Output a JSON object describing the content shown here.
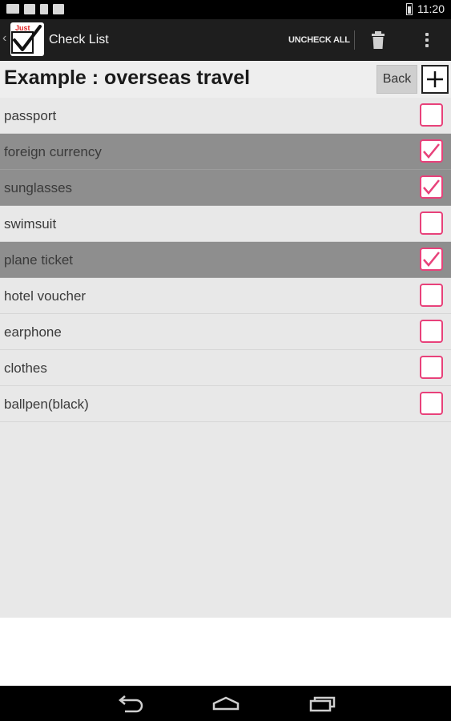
{
  "status_bar": {
    "time": "11:20",
    "icons": [
      "mail-icon",
      "image-icon",
      "sd-card-icon",
      "clipboard-icon",
      "battery-icon"
    ]
  },
  "action_bar": {
    "title": "Check List",
    "uncheck_all_label": "UNCHECK ALL",
    "app_icon_text": "Just",
    "icons": [
      "trash-icon",
      "overflow-menu-icon"
    ]
  },
  "list": {
    "title": "Example : overseas travel",
    "back_label": "Back",
    "items": [
      {
        "label": "passport",
        "checked": false
      },
      {
        "label": "foreign currency",
        "checked": true
      },
      {
        "label": "sunglasses",
        "checked": true
      },
      {
        "label": "swimsuit",
        "checked": false
      },
      {
        "label": "plane ticket",
        "checked": true
      },
      {
        "label": "hotel voucher",
        "checked": false
      },
      {
        "label": "earphone",
        "checked": false
      },
      {
        "label": "clothes",
        "checked": false
      },
      {
        "label": "ballpen(black)",
        "checked": false
      }
    ]
  },
  "nav_bar": {
    "icons": [
      "back-icon",
      "home-icon",
      "recent-apps-icon"
    ]
  },
  "colors": {
    "checkbox_accent": "#e8417a",
    "checked_row": "#8e8e8e",
    "row": "#e8e8e8",
    "action_bar": "#1e1e1e"
  }
}
